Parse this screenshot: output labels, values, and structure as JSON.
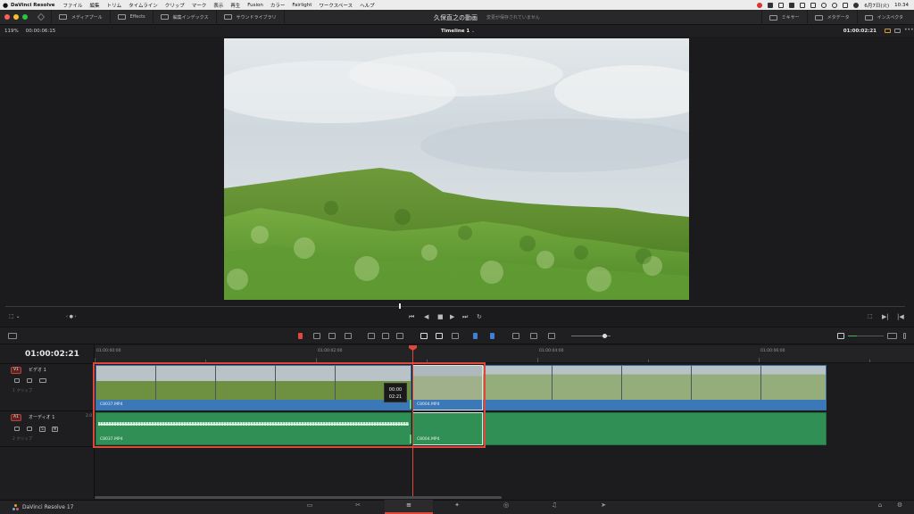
{
  "menubar": {
    "app_name": "DaVinci Resolve",
    "items": [
      "ファイル",
      "編集",
      "トリム",
      "タイムライン",
      "クリップ",
      "マーク",
      "表示",
      "再生",
      "Fusion",
      "カラー",
      "Fairlight",
      "ワークスペース",
      "ヘルプ"
    ],
    "date": "6月7日(火)",
    "time": "10:34"
  },
  "toolbar": {
    "left_buttons": [
      "メディアプール",
      "Effects",
      "編集インデックス",
      "サウンドライブラリ"
    ],
    "project_title": "久保直之の動画",
    "unsaved_text": "変更が保存されていません",
    "right_buttons": [
      "ミキサー",
      "メタデータ",
      "インスペクタ"
    ]
  },
  "viewer": {
    "zoom": "119%",
    "timecode_left": "00:00:06:15",
    "timeline_name": "Timeline 1",
    "timecode_right": "01:00:02:21"
  },
  "timeline": {
    "current_timecode": "01:00:02:21",
    "ruler": [
      "01:00:00:00",
      "01:00:02:00",
      "01:00:04:00",
      "01:00:06:00"
    ],
    "tracks": [
      {
        "tag": "V1",
        "name": "ビデオ 1",
        "sub": "1 クリップ"
      },
      {
        "tag": "A1",
        "name": "オーディオ 1",
        "sub": "2 クリップ",
        "channel": "2.0"
      }
    ],
    "audio_buttons": [
      "S",
      "M"
    ],
    "clips": {
      "video_a": "C8037.MP4",
      "video_b": "C8004.MP4",
      "audio_a": "C8037.MP4",
      "audio_b": "C8004.MP4"
    },
    "tooltip_top": "00:00",
    "tooltip_bottom": "02:21"
  },
  "pagebar": {
    "brand": "DaVinci Resolve 17"
  },
  "colors": {
    "accent_red": "#e0473b",
    "video_clip": "#3a78b8",
    "audio_clip": "#2f8f55"
  }
}
